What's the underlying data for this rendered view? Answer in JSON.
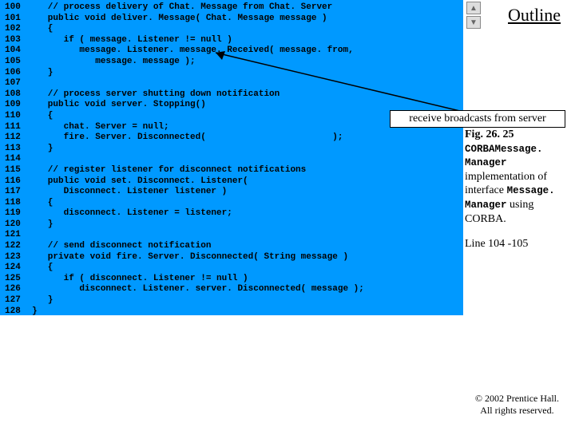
{
  "outline": {
    "title": "Outline"
  },
  "sidebar": {
    "fig_label": "Fig. 26. 25",
    "class_name": "CORBAMessage. Manager",
    "desc1": "implementation of interface",
    "iface_name": "Message. Manager",
    "desc2": " using CORBA.",
    "line_ref": "Line 104 -105"
  },
  "callout": {
    "text": "receive broadcasts from server"
  },
  "copyright": {
    "line1": "© 2002 Prentice Hall.",
    "line2": "All rights reserved."
  },
  "gutter": [
    "100",
    "101",
    "102",
    "103",
    "104",
    "105",
    "106",
    "107",
    "108",
    "109",
    "110",
    "111",
    "112",
    "113",
    "114",
    "115",
    "116",
    "117",
    "118",
    "119",
    "120",
    "121",
    "122",
    "123",
    "124",
    "125",
    "126",
    "127",
    "128"
  ],
  "code": [
    "   // process delivery of Chat. Message from Chat. Server",
    "   public void deliver. Message( Chat. Message message )",
    "   {",
    "      if ( message. Listener != null )",
    "         message. Listener. message. Received( message. from,",
    "            message. message );",
    "   }",
    "",
    "   // process server shutting down notification",
    "   public void server. Stopping()",
    "   {",
    "      chat. Server = null;",
    "      fire. Server. Disconnected(                        );",
    "   }",
    "",
    "   // register listener for disconnect notifications",
    "   public void set. Disconnect. Listener(",
    "      Disconnect. Listener listener )",
    "   {",
    "      disconnect. Listener = listener;",
    "   }",
    "",
    "   // send disconnect notification",
    "   private void fire. Server. Disconnected( String message )",
    "   {",
    "      if ( disconnect. Listener != null )",
    "         disconnect. Listener. server. Disconnected( message );",
    "   }",
    "}"
  ]
}
